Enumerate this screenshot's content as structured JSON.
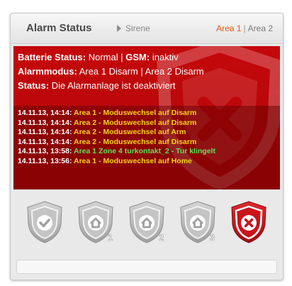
{
  "header": {
    "title": "Alarm Status",
    "sirene_label": "Sirene",
    "area1_label": "Area 1",
    "separator": "|",
    "area2_label": "Area 2"
  },
  "status": {
    "battery_label": "Batterie Status:",
    "battery_value": "Normal",
    "sep1": "|",
    "gsm_label": "GSM:",
    "gsm_value": "inaktiv",
    "mode_label": "Alarmmodus:",
    "mode_value": "Area 1 Disarm | Area 2 Disarm",
    "state_label": "Status:",
    "state_value": "Die Alarmanlage ist deaktiviert"
  },
  "log": [
    {
      "time": "14.11.13, 14:14:",
      "message": "Area 1 - Moduswechsel auf Disarm",
      "color": "yellow"
    },
    {
      "time": "14.11.13, 14:14:",
      "message": "Area 2 - Moduswechsel auf Disarm",
      "color": "yellow"
    },
    {
      "time": "14.11.13, 14:14:",
      "message": "Area 2 - Moduswechsel auf Arm",
      "color": "yellow"
    },
    {
      "time": "14.11.13, 14:14:",
      "message": "Area 2 - Moduswechsel auf Disarm",
      "color": "yellow"
    },
    {
      "time": "14.11.13, 13:58:",
      "message": "Area 1 Zone 4 turkontakt_2 - Tur klingelt",
      "color": "green"
    },
    {
      "time": "14.11.13, 13:56:",
      "message": "Area 1 - Moduswechsel auf Home",
      "color": "yellow"
    }
  ],
  "mode_buttons": [
    {
      "icon": "check-shield-icon",
      "number": ""
    },
    {
      "icon": "home-shield-icon",
      "number": "1"
    },
    {
      "icon": "home-shield-icon",
      "number": "2"
    },
    {
      "icon": "home-shield-icon",
      "number": "3"
    },
    {
      "icon": "x-shield-icon",
      "number": ""
    }
  ],
  "colors": {
    "panel_red": "#c4080b",
    "log_yellow": "#f2d21e",
    "log_green": "#5fe05a",
    "area_active": "#e05a1a",
    "button_grey": "#b8b8b8",
    "button_red": "#c8141a"
  }
}
